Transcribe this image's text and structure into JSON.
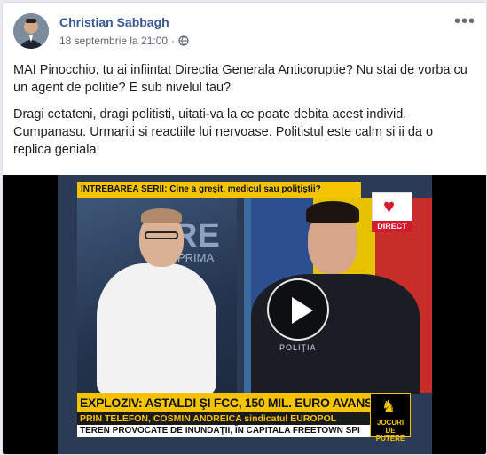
{
  "post": {
    "author": "Christian Sabbagh",
    "timestamp": "18 septembrie la 21:00",
    "separator": "·",
    "privacy_icon": "globe-icon",
    "more_label": "•••",
    "paragraphs": [
      "MAI Pinocchio, tu ai infiintat Directia Generala Anticoruptie? Nu stai de vorba cu un agent de politie? E sub nivelul tau?",
      "Dragi cetateni, dragi politisti, uitati-va la ce poate debita acest individ, Cumpanasu. Urmariti si reactiile lui nervoase. Politistul este calm si ii da o replica geniala!"
    ]
  },
  "video": {
    "top_banner": "ÎNTREBAREA SERII: Cine a greşit, medicul sau poliţiştii?",
    "channel_badge": "DIRECT",
    "studio_text": "RE",
    "studio_sub": "PRIMA",
    "uniform_text": "POLIŢIA",
    "headline": "EXPLOZIV: ASTALDI ŞI FCC, 150 MIL. EURO AVANS DE LA MT",
    "subline": "PRIN TELEFON, COSMIN ANDREICA sindicatul EUROPOL",
    "ticker": "TEREN PROVOCATE DE INUNDAŢII, ÎN CAPITALA FREETOWN    SPI",
    "sponsor": "JOCURI DE PUTERE",
    "play_icon": "play-icon"
  },
  "colors": {
    "link": "#385898",
    "text": "#1c1e21",
    "meta": "#606770",
    "banner_yellow": "#f5c400",
    "badge_red": "#d31a2a"
  }
}
